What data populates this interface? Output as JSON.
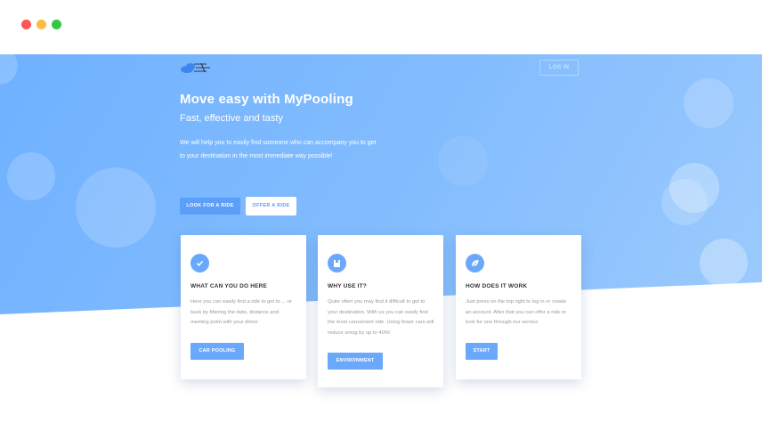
{
  "window": {
    "controls": [
      "close",
      "minimize",
      "maximize"
    ]
  },
  "nav": {
    "logo_icon": "cloud-road-logo-icon",
    "login_label": "LOG IN"
  },
  "hero": {
    "title": "Move easy with MyPooling",
    "subtitle": "Fast, effective and tasty",
    "description": "We will help you to easily find someone who can accompany you to get to your destination in the most immediate way possible!",
    "look_label": "LOOK FOR A RIDE",
    "offer_label": "OFFER A RIDE"
  },
  "cards": [
    {
      "icon": "check-icon",
      "title": "WHAT CAN YOU DO HERE",
      "text": "Here you can easily find a ride to get to ... or back by filtering the date, distance and meeting point with your driver",
      "button": "CAR POOLING"
    },
    {
      "icon": "building-icon",
      "title": "WHY USE IT?",
      "text": "Quite often you may find it difficult to get to your destination. With us you can easily find the most convenient ride. Using fewer cars will reduce smog by up to 40%!",
      "button": "ENVIRONMENT"
    },
    {
      "icon": "leaf-icon",
      "title": "HOW DOES IT WORK",
      "text": "Just press on the top right to log in or create an account. After that you can offer a ride or look for one through our service",
      "button": "START"
    }
  ],
  "colors": {
    "primary": "#6aa8fb",
    "hero_start": "#6fb1ff",
    "hero_end": "#9ccafd"
  }
}
